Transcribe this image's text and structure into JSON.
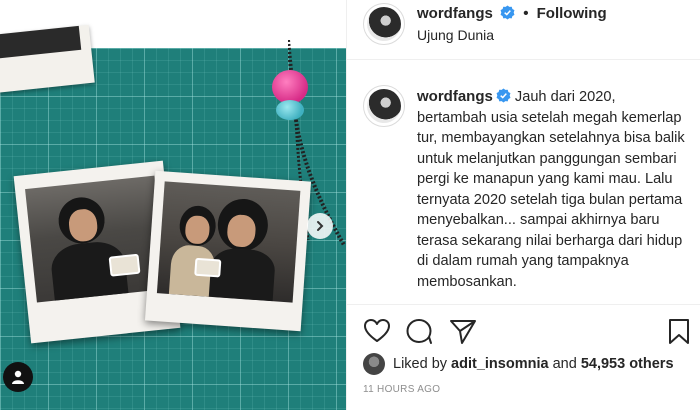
{
  "post": {
    "username": "wordfangs",
    "follow_status": "Following",
    "location": "Ujung Dunia",
    "caption": "Jauh dari 2020, bertambah usia setelah megah kemerlap tur, membayangkan setelahnya bisa balik untuk melanjutkan panggungan sembari pergi ke manapun yang kami mau. Lalu ternyata 2020 setelah tiga bulan pertama menyebalkan... sampai akhirnya baru terasa sekarang nilai berharga dari hidup di dalam rumah yang tampaknya membosankan.",
    "liked_by_prefix": "Liked by",
    "liked_by_user": "adit_insomnia",
    "liked_by_and": "and",
    "likes_count": "54,953 others",
    "timestamp": "11 HOURS AGO"
  },
  "colors": {
    "verified": "#3897f0",
    "mat_background": "#1f7f7a",
    "text": "#262626",
    "muted": "#8e8e8e"
  },
  "icons": {
    "verified": "verified-badge-icon",
    "like": "heart-icon",
    "comment": "comment-bubble-icon",
    "share": "paper-plane-icon",
    "save": "bookmark-icon",
    "next": "chevron-right-icon",
    "tags": "person-tag-icon"
  }
}
